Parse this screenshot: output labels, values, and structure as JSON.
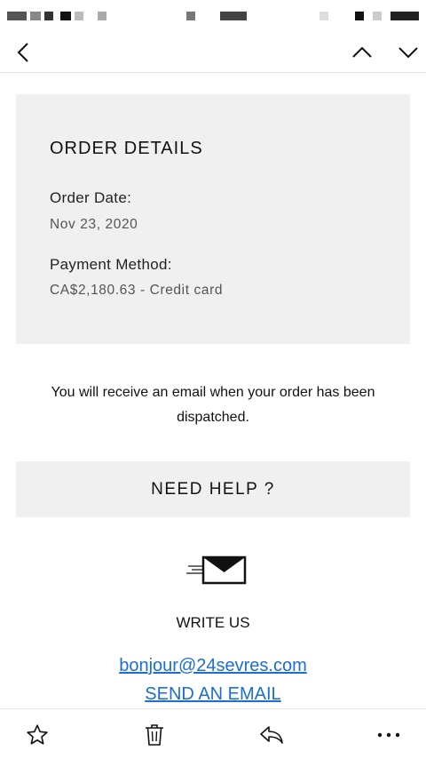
{
  "nav": {
    "back_icon": "chevron-left-icon",
    "prev_icon": "chevron-up-icon",
    "next_icon": "chevron-down-icon"
  },
  "order_details": {
    "title": "ORDER DETAILS",
    "order_date_label": "Order Date:",
    "order_date_value": "Nov 23, 2020",
    "payment_method_label": "Payment Method:",
    "payment_method_value": "CA$2,180.63 - Credit card"
  },
  "message": "You will receive an email when your order has been dispatched.",
  "help": {
    "button_label": "NEED HELP ?",
    "envelope_icon": "envelope-icon",
    "write_us_label": "WRITE US",
    "email_link": "bonjour@24sevres.com",
    "send_email_link": "SEND AN EMAIL"
  },
  "toolbar": {
    "items": [
      "star-icon",
      "trash-icon",
      "reply-icon",
      "more-icon"
    ]
  },
  "colors": {
    "link": "#1a6fd1",
    "panel": "#f0f0f0",
    "text": "#111111"
  }
}
